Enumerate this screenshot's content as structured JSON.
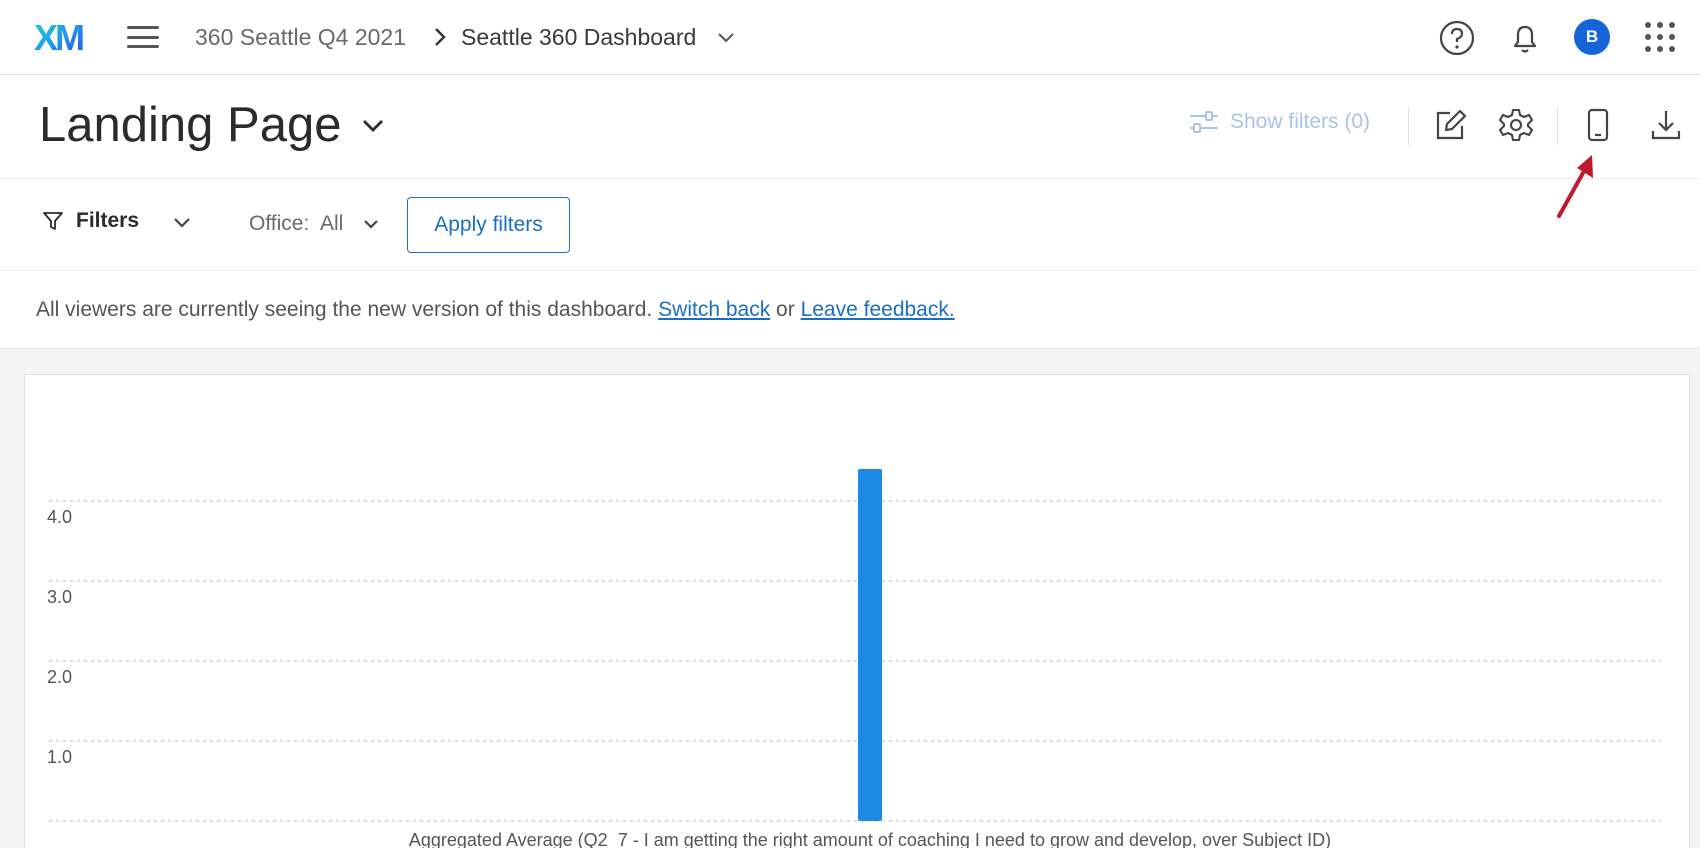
{
  "header": {
    "logo_text": "XM",
    "breadcrumb_project": "360 Seattle Q4 2021",
    "breadcrumb_dashboard": "Seattle 360 Dashboard",
    "avatar_initial": "B",
    "icons": [
      "menu-icon",
      "chevron-right-icon",
      "chevron-down-icon",
      "help-icon",
      "bell-icon",
      "apps-grid-icon"
    ]
  },
  "page": {
    "title": "Landing Page",
    "show_filters_label": "Show filters (0)",
    "icons": [
      "edit-icon",
      "gear-icon",
      "mobile-icon",
      "download-icon"
    ]
  },
  "filters": {
    "filters_label": "Filters",
    "office_label": "Office:",
    "office_value": "All",
    "apply_label": "Apply filters"
  },
  "notice": {
    "text": "All viewers are currently seeing the new version of this dashboard.",
    "switch_back": "Switch back",
    "or_text": "or",
    "leave_feedback": "Leave feedback."
  },
  "colors": {
    "accent": "#1a6fc4",
    "bar": "#1e88e5",
    "avatar": "#1565d8",
    "annotation_arrow": "#c0182c"
  },
  "chart_data": {
    "type": "bar",
    "categories": [
      ""
    ],
    "values": [
      4.4
    ],
    "yticks": [
      "1.0",
      "2.0",
      "3.0",
      "4.0"
    ],
    "ylim": [
      0,
      4.4
    ],
    "grid": true,
    "xlabel": "Aggregated Average (Q2_7 - I am getting the right amount of coaching I need to grow and develop, over Subject ID)"
  }
}
